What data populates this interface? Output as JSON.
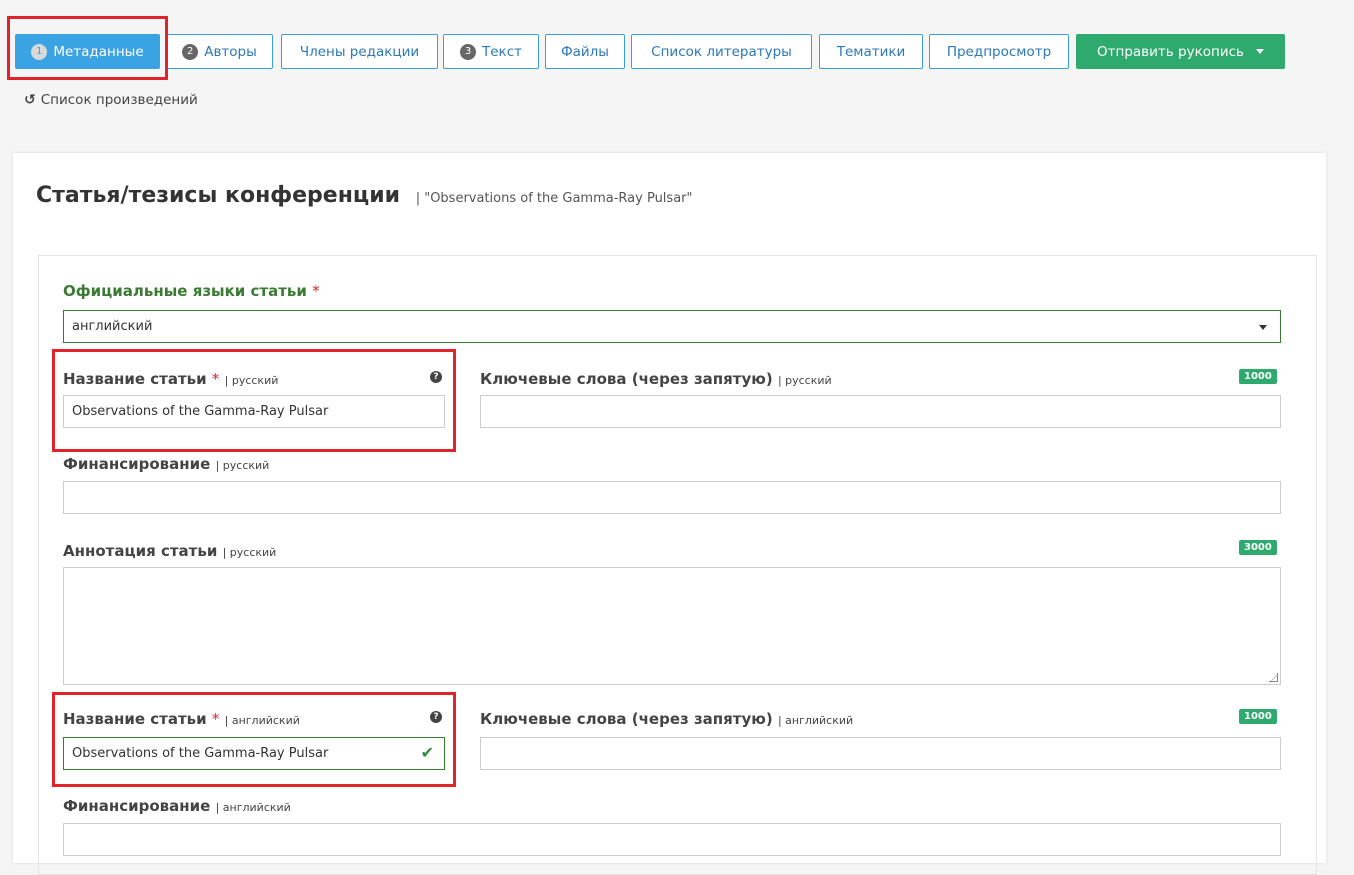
{
  "nav": {
    "tabs": [
      {
        "num": "1",
        "label": "Метаданные"
      },
      {
        "num": "2",
        "label": "Авторы"
      },
      {
        "num": "",
        "label": "Члены редакции"
      },
      {
        "num": "3",
        "label": "Текст"
      },
      {
        "num": "",
        "label": "Файлы"
      },
      {
        "num": "",
        "label": "Список литературы"
      },
      {
        "num": "",
        "label": "Тематики"
      },
      {
        "num": "",
        "label": "Предпросмотр"
      }
    ],
    "send_label": "Отправить рукопись"
  },
  "back_link": "Список произведений",
  "page": {
    "title": "Статья/тезисы конференции",
    "subtitle": "| \"Observations of the Gamma-Ray Pulsar\""
  },
  "form": {
    "languages": {
      "label": "Официальные языки статьи",
      "star": "*",
      "value": "английский"
    },
    "title_ru": {
      "label": "Название статьи",
      "star": "*",
      "sub": "| русский",
      "value": "Observations of the Gamma-Ray Pulsar"
    },
    "keywords_ru": {
      "label": "Ключевые слова (через запятую)",
      "sub": "| русский",
      "counter": "1000",
      "value": ""
    },
    "funding_ru": {
      "label": "Финансирование",
      "sub": "| русский",
      "value": ""
    },
    "abstract_ru": {
      "label": "Аннотация статьи",
      "sub": "| русский",
      "counter": "3000",
      "value": ""
    },
    "title_en": {
      "label": "Название статьи",
      "star": "*",
      "sub": "| английский",
      "value": "Observations of the Gamma-Ray Pulsar"
    },
    "keywords_en": {
      "label": "Ключевые слова (через запятую)",
      "sub": "| английский",
      "counter": "1000",
      "value": ""
    },
    "funding_en": {
      "label": "Финансирование",
      "sub": "| английский",
      "value": ""
    }
  },
  "icons": {
    "help": "?",
    "check": "✔",
    "back": "↺"
  },
  "colors": {
    "accent": "#3aa3e3",
    "send": "#2eaa6e",
    "highlight": "#e0242c",
    "label_green": "#3a7a32"
  }
}
